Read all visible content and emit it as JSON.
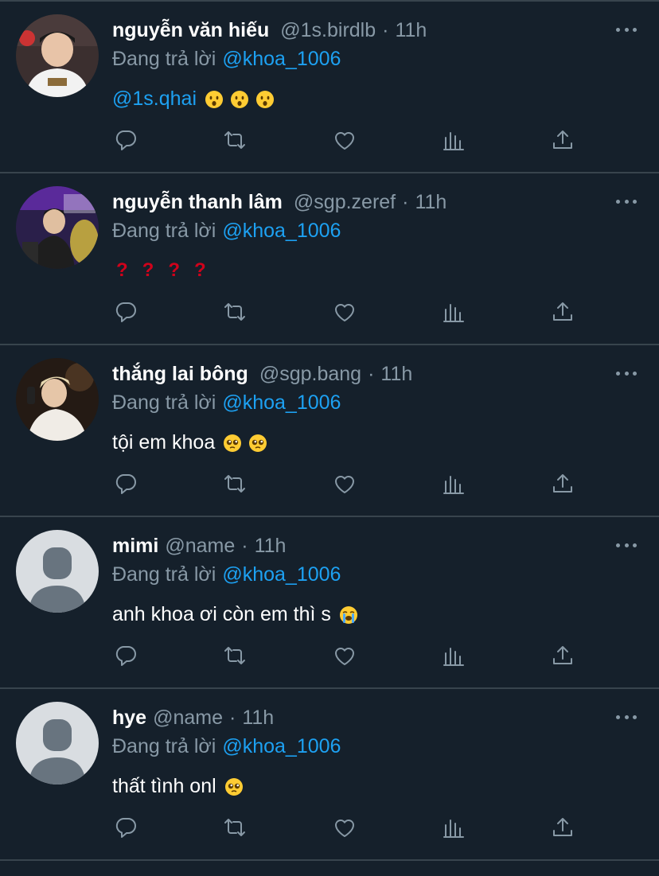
{
  "colors": {
    "background": "#15202b",
    "divider": "#38444d",
    "secondary_text": "#8899a6",
    "link": "#1da1f2",
    "question_mark": "#d0021b"
  },
  "tweets": [
    {
      "name": "nguyễn văn hiếu",
      "handle": "@1s.birdlb",
      "dot": "·",
      "time": "11h",
      "replying_label": "Đang trả lời",
      "replying_to": "@khoa_1006",
      "body_mention": "@1s.qhai",
      "body_text": "",
      "emoji": [
        "hushed-face",
        "hushed-face",
        "hushed-face"
      ],
      "avatar": "photo"
    },
    {
      "name": "nguyễn thanh lâm",
      "handle": "@sgp.zeref",
      "dot": "·",
      "time": "11h",
      "replying_label": "Đang trả lời",
      "replying_to": "@khoa_1006",
      "body_mention": "",
      "body_text": "",
      "question_marks": [
        "?",
        "?",
        "?",
        "?"
      ],
      "emoji": [],
      "avatar": "photo"
    },
    {
      "name": "thắng lai bông",
      "handle": "@sgp.bang",
      "dot": "·",
      "time": "11h",
      "replying_label": "Đang trả lời",
      "replying_to": "@khoa_1006",
      "body_mention": "",
      "body_text": "tội em khoa",
      "emoji": [
        "pleading-face",
        "pleading-face"
      ],
      "avatar": "photo"
    },
    {
      "name": "mimi",
      "handle": "@name",
      "dot": "·",
      "time": "11h",
      "replying_label": "Đang trả lời",
      "replying_to": "@khoa_1006",
      "body_mention": "",
      "body_text": "anh khoa ơi còn em thì s",
      "emoji": [
        "loudly-crying-face"
      ],
      "avatar": "default"
    },
    {
      "name": "hye",
      "handle": "@name",
      "dot": "·",
      "time": "11h",
      "replying_label": "Đang trả lời",
      "replying_to": "@khoa_1006",
      "body_mention": "",
      "body_text": "thất tình onl",
      "emoji": [
        "pleading-face"
      ],
      "avatar": "default"
    }
  ],
  "action_icons": [
    "reply-icon",
    "retweet-icon",
    "like-icon",
    "analytics-icon",
    "share-icon"
  ]
}
